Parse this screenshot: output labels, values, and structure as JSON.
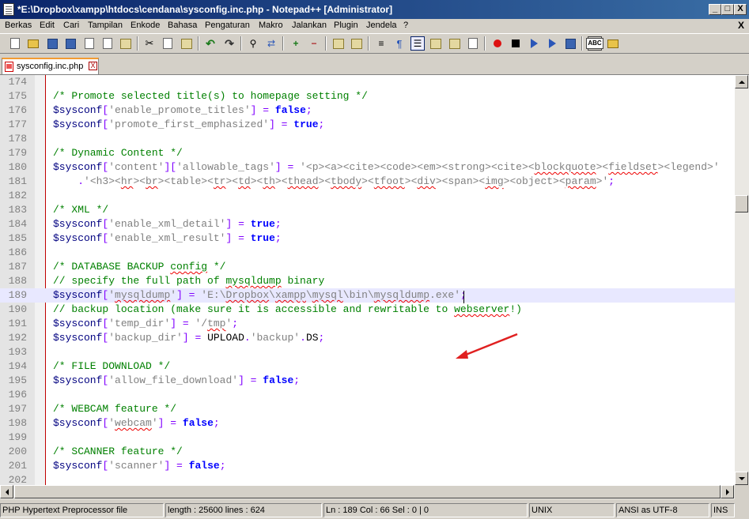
{
  "window": {
    "title": "*E:\\Dropbox\\xampp\\htdocs\\cendana\\sysconfig.inc.php - Notepad++ [Administrator]",
    "minimize": "_",
    "maximize": "□",
    "close": "X"
  },
  "menu": {
    "items": [
      "Berkas",
      "Edit",
      "Cari",
      "Tampilan",
      "Enkode",
      "Bahasa",
      "Pengaturan",
      "Makro",
      "Jalankan",
      "Plugin",
      "Jendela",
      "?"
    ],
    "close": "X"
  },
  "toolbar": {
    "icons": [
      "new-file-icon",
      "open-file-icon",
      "save-icon",
      "save-all-icon",
      "close-icon",
      "close-all-icon",
      "print-icon",
      "cut-icon",
      "copy-icon",
      "paste-icon",
      "undo-icon",
      "redo-icon",
      "find-icon",
      "replace-icon",
      "zoom-in-icon",
      "zoom-out-icon",
      "sync-vertical-icon",
      "sync-horizontal-icon",
      "word-wrap-icon",
      "show-all-chars-icon",
      "indent-guide-icon",
      "udl-icon",
      "doc-map-icon",
      "function-list-icon",
      "record-macro-icon",
      "stop-macro-icon",
      "play-macro-icon",
      "run-macro-multiple-icon",
      "save-macro-icon",
      "spellcheck-icon",
      "plugin-icon"
    ],
    "spellcheck_label": "ABC"
  },
  "tabs": [
    {
      "label": "sysconfig.inc.php",
      "close": "X",
      "active": true
    }
  ],
  "editor": {
    "current_line": 189,
    "lines": [
      {
        "n": "174",
        "tokens": []
      },
      {
        "n": "175",
        "tokens": [
          {
            "t": "/* Promote selected title(s) to homepage setting */",
            "c": "c-comment"
          }
        ]
      },
      {
        "n": "176",
        "tokens": [
          {
            "t": "$sysconf",
            "c": "c-var"
          },
          {
            "t": "[",
            "c": "c-op"
          },
          {
            "t": "'enable_promote_titles'",
            "c": "c-str"
          },
          {
            "t": "] = ",
            "c": "c-op"
          },
          {
            "t": "false",
            "c": "c-kw"
          },
          {
            "t": ";",
            "c": "c-op"
          }
        ]
      },
      {
        "n": "177",
        "tokens": [
          {
            "t": "$sysconf",
            "c": "c-var"
          },
          {
            "t": "[",
            "c": "c-op"
          },
          {
            "t": "'promote_first_emphasized'",
            "c": "c-str"
          },
          {
            "t": "] = ",
            "c": "c-op"
          },
          {
            "t": "true",
            "c": "c-kw"
          },
          {
            "t": ";",
            "c": "c-op"
          }
        ]
      },
      {
        "n": "178",
        "tokens": []
      },
      {
        "n": "179",
        "tokens": [
          {
            "t": "/* Dynamic Content */",
            "c": "c-comment"
          }
        ]
      },
      {
        "n": "180",
        "tokens": [
          {
            "t": "$sysconf",
            "c": "c-var"
          },
          {
            "t": "[",
            "c": "c-op"
          },
          {
            "t": "'content'",
            "c": "c-str"
          },
          {
            "t": "][",
            "c": "c-op"
          },
          {
            "t": "'allowable_tags'",
            "c": "c-str"
          },
          {
            "t": "] = ",
            "c": "c-op"
          },
          {
            "t": "'<p><a><cite><code><em><strong><cite><",
            "c": "c-str"
          },
          {
            "t": "blockquote",
            "c": "c-str squig"
          },
          {
            "t": "><",
            "c": "c-str"
          },
          {
            "t": "fieldset",
            "c": "c-str squig"
          },
          {
            "t": "><legend>'",
            "c": "c-str"
          }
        ]
      },
      {
        "n": "181",
        "tokens": [
          {
            "t": "    .",
            "c": "c-op"
          },
          {
            "t": "'<h3><",
            "c": "c-str"
          },
          {
            "t": "hr",
            "c": "c-str squig"
          },
          {
            "t": "><",
            "c": "c-str"
          },
          {
            "t": "br",
            "c": "c-str squig"
          },
          {
            "t": "><table><",
            "c": "c-str"
          },
          {
            "t": "tr",
            "c": "c-str squig"
          },
          {
            "t": "><",
            "c": "c-str"
          },
          {
            "t": "td",
            "c": "c-str squig"
          },
          {
            "t": "><",
            "c": "c-str"
          },
          {
            "t": "th",
            "c": "c-str squig"
          },
          {
            "t": "><",
            "c": "c-str"
          },
          {
            "t": "thead",
            "c": "c-str squig"
          },
          {
            "t": "><",
            "c": "c-str"
          },
          {
            "t": "tbody",
            "c": "c-str squig"
          },
          {
            "t": "><",
            "c": "c-str"
          },
          {
            "t": "tfoot",
            "c": "c-str squig"
          },
          {
            "t": "><",
            "c": "c-str"
          },
          {
            "t": "div",
            "c": "c-str squig"
          },
          {
            "t": "><span><",
            "c": "c-str"
          },
          {
            "t": "img",
            "c": "c-str squig"
          },
          {
            "t": "><object><",
            "c": "c-str"
          },
          {
            "t": "param",
            "c": "c-str squig"
          },
          {
            "t": ">'",
            "c": "c-str"
          },
          {
            "t": ";",
            "c": "c-op"
          }
        ]
      },
      {
        "n": "182",
        "tokens": []
      },
      {
        "n": "183",
        "tokens": [
          {
            "t": "/* XML */",
            "c": "c-comment"
          }
        ]
      },
      {
        "n": "184",
        "tokens": [
          {
            "t": "$sysconf",
            "c": "c-var"
          },
          {
            "t": "[",
            "c": "c-op"
          },
          {
            "t": "'enable_xml_detail'",
            "c": "c-str"
          },
          {
            "t": "] = ",
            "c": "c-op"
          },
          {
            "t": "true",
            "c": "c-kw"
          },
          {
            "t": ";",
            "c": "c-op"
          }
        ]
      },
      {
        "n": "185",
        "tokens": [
          {
            "t": "$sysconf",
            "c": "c-var"
          },
          {
            "t": "[",
            "c": "c-op"
          },
          {
            "t": "'enable_xml_result'",
            "c": "c-str"
          },
          {
            "t": "] = ",
            "c": "c-op"
          },
          {
            "t": "true",
            "c": "c-kw"
          },
          {
            "t": ";",
            "c": "c-op"
          }
        ]
      },
      {
        "n": "186",
        "tokens": []
      },
      {
        "n": "187",
        "tokens": [
          {
            "t": "/* DATABASE BACKUP ",
            "c": "c-comment"
          },
          {
            "t": "config",
            "c": "c-comment squig"
          },
          {
            "t": " */",
            "c": "c-comment"
          }
        ]
      },
      {
        "n": "188",
        "tokens": [
          {
            "t": "// specify the full path of ",
            "c": "c-comment"
          },
          {
            "t": "mysqldump",
            "c": "c-comment squig"
          },
          {
            "t": " binary",
            "c": "c-comment"
          }
        ]
      },
      {
        "n": "189",
        "tokens": [
          {
            "t": "$sysconf",
            "c": "c-var"
          },
          {
            "t": "[",
            "c": "c-op"
          },
          {
            "t": "'",
            "c": "c-str"
          },
          {
            "t": "mysqldump",
            "c": "c-str squig"
          },
          {
            "t": "'",
            "c": "c-str"
          },
          {
            "t": "] = ",
            "c": "c-op"
          },
          {
            "t": "'E:\\",
            "c": "c-str"
          },
          {
            "t": "Dropbox",
            "c": "c-str squig"
          },
          {
            "t": "\\",
            "c": "c-str"
          },
          {
            "t": "xampp",
            "c": "c-str squig"
          },
          {
            "t": "\\",
            "c": "c-str"
          },
          {
            "t": "mysql",
            "c": "c-str squig"
          },
          {
            "t": "\\bin\\",
            "c": "c-str"
          },
          {
            "t": "mysqldump",
            "c": "c-str squig"
          },
          {
            "t": ".exe'",
            "c": "c-str"
          },
          {
            "t": ";",
            "c": "c-op"
          }
        ]
      },
      {
        "n": "190",
        "tokens": [
          {
            "t": "// backup location (make sure it is accessible and rewritable to ",
            "c": "c-comment"
          },
          {
            "t": "webserver",
            "c": "c-comment squig"
          },
          {
            "t": "!)",
            "c": "c-comment"
          }
        ]
      },
      {
        "n": "191",
        "tokens": [
          {
            "t": "$sysconf",
            "c": "c-var"
          },
          {
            "t": "[",
            "c": "c-op"
          },
          {
            "t": "'temp_dir'",
            "c": "c-str"
          },
          {
            "t": "] = ",
            "c": "c-op"
          },
          {
            "t": "'/",
            "c": "c-str"
          },
          {
            "t": "tmp",
            "c": "c-str squig"
          },
          {
            "t": "'",
            "c": "c-str"
          },
          {
            "t": ";",
            "c": "c-op"
          }
        ]
      },
      {
        "n": "192",
        "tokens": [
          {
            "t": "$sysconf",
            "c": "c-var"
          },
          {
            "t": "[",
            "c": "c-op"
          },
          {
            "t": "'backup_dir'",
            "c": "c-str"
          },
          {
            "t": "] = ",
            "c": "c-op"
          },
          {
            "t": "UPLOAD",
            "c": "c-plain"
          },
          {
            "t": ".",
            "c": "c-op"
          },
          {
            "t": "'backup'",
            "c": "c-str"
          },
          {
            "t": ".",
            "c": "c-op"
          },
          {
            "t": "DS",
            "c": "c-plain"
          },
          {
            "t": ";",
            "c": "c-op"
          }
        ]
      },
      {
        "n": "193",
        "tokens": []
      },
      {
        "n": "194",
        "tokens": [
          {
            "t": "/* FILE DOWNLOAD */",
            "c": "c-comment"
          }
        ]
      },
      {
        "n": "195",
        "tokens": [
          {
            "t": "$sysconf",
            "c": "c-var"
          },
          {
            "t": "[",
            "c": "c-op"
          },
          {
            "t": "'allow_file_download'",
            "c": "c-str"
          },
          {
            "t": "] = ",
            "c": "c-op"
          },
          {
            "t": "false",
            "c": "c-kw"
          },
          {
            "t": ";",
            "c": "c-op"
          }
        ]
      },
      {
        "n": "196",
        "tokens": []
      },
      {
        "n": "197",
        "tokens": [
          {
            "t": "/* WEBCAM feature */",
            "c": "c-comment"
          }
        ]
      },
      {
        "n": "198",
        "tokens": [
          {
            "t": "$sysconf",
            "c": "c-var"
          },
          {
            "t": "[",
            "c": "c-op"
          },
          {
            "t": "'",
            "c": "c-str"
          },
          {
            "t": "webcam",
            "c": "c-str squig"
          },
          {
            "t": "'",
            "c": "c-str"
          },
          {
            "t": "] = ",
            "c": "c-op"
          },
          {
            "t": "false",
            "c": "c-kw"
          },
          {
            "t": ";",
            "c": "c-op"
          }
        ]
      },
      {
        "n": "199",
        "tokens": []
      },
      {
        "n": "200",
        "tokens": [
          {
            "t": "/* SCANNER feature */",
            "c": "c-comment"
          }
        ]
      },
      {
        "n": "201",
        "tokens": [
          {
            "t": "$sysconf",
            "c": "c-var"
          },
          {
            "t": "[",
            "c": "c-op"
          },
          {
            "t": "'scanner'",
            "c": "c-str"
          },
          {
            "t": "] = ",
            "c": "c-op"
          },
          {
            "t": "false",
            "c": "c-kw"
          },
          {
            "t": ";",
            "c": "c-op"
          }
        ]
      },
      {
        "n": "202",
        "tokens": []
      }
    ]
  },
  "status": {
    "file_type": "PHP Hypertext Preprocessor file",
    "length_lines": "length : 25600    lines : 624",
    "position": "Ln : 189    Col : 66    Sel : 0 | 0",
    "eol": "UNIX",
    "encoding": "ANSI as UTF-8",
    "mode": "INS"
  },
  "colors": {
    "title_gradient_start": "#0a246a",
    "title_gradient_end": "#3a6ea5",
    "current_line": "#e8e8ff",
    "comment": "#008000",
    "variable": "#000080",
    "string": "#808080",
    "keyword": "#0000ff",
    "operator": "#8000ff",
    "annotation_arrow": "#e02020"
  }
}
